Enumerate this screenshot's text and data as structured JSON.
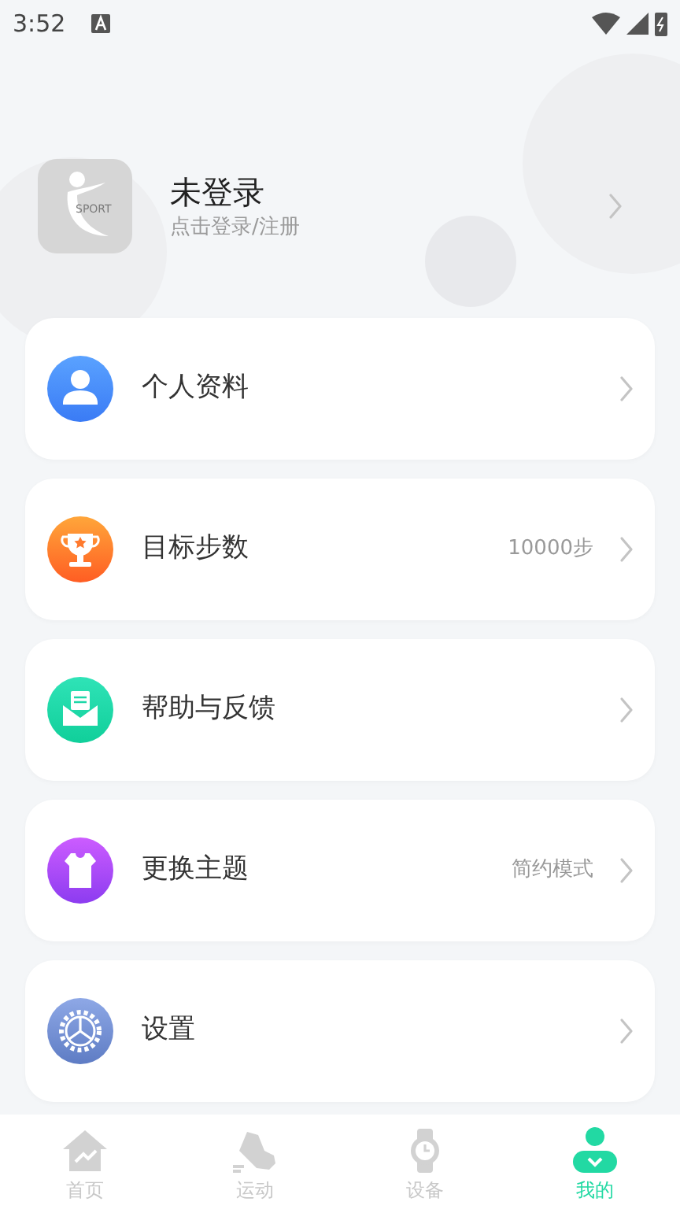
{
  "status_bar": {
    "time": "3:52"
  },
  "profile": {
    "name": "未登录",
    "hint": "点击登录/注册",
    "logo_text": "SPORT"
  },
  "menu": [
    {
      "kind": "profile",
      "label": "个人资料"
    },
    {
      "kind": "trophy",
      "label": "目标步数",
      "value": "10000步"
    },
    {
      "kind": "mail",
      "label": "帮助与反馈"
    },
    {
      "kind": "shirt",
      "label": "更换主题",
      "value": "简约模式"
    },
    {
      "kind": "gear",
      "label": "设置"
    }
  ],
  "tab_bar": [
    {
      "kind": "home",
      "label": "首页",
      "selected": false
    },
    {
      "kind": "shoe",
      "label": "运动",
      "selected": false
    },
    {
      "kind": "watch",
      "label": "设备",
      "selected": false
    },
    {
      "kind": "me",
      "label": "我的",
      "selected": true
    }
  ]
}
